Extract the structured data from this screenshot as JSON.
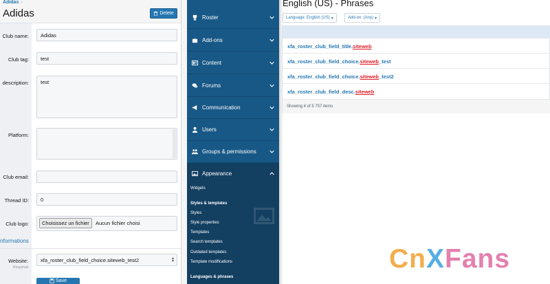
{
  "left": {
    "breadcrumb": "Adidas",
    "breadcrumb_sep": "›",
    "title": "Adidas",
    "delete_label": "Delete",
    "fields": {
      "club_name_label": "Club name:",
      "club_name_value": "Adidas",
      "club_tag_label": "Club tag:",
      "club_tag_value": "test",
      "description_label": "description:",
      "description_value": "test",
      "platform_label": "Platform:",
      "club_email_label": "Club email:",
      "thread_id_label": "Thread ID:",
      "thread_id_value": "0",
      "club_logo_label": "Club logo:",
      "file_button": "Choisissez un fichier",
      "file_status": "Aucun fichier choisi"
    },
    "section_heading": "nformations",
    "website_label": "Website:",
    "required_label": "Required",
    "website_value": "xfa_roster_club_field_choice.siteweb_test2",
    "save_label": "Save"
  },
  "nav": {
    "items": [
      {
        "label": "Roster",
        "icon": "trophy-icon"
      },
      {
        "label": "Add-ons",
        "icon": "puzzle-icon"
      },
      {
        "label": "Content",
        "icon": "content-icon"
      },
      {
        "label": "Forums",
        "icon": "forums-icon"
      },
      {
        "label": "Communication",
        "icon": "megaphone-icon"
      },
      {
        "label": "Users",
        "icon": "user-icon"
      },
      {
        "label": "Groups & permissions",
        "icon": "users-group-icon"
      },
      {
        "label": "Appearance",
        "icon": "image-icon"
      }
    ],
    "sub_items": [
      {
        "label": "Widgets",
        "bold": false
      },
      {
        "label": "Styles & templates",
        "bold": true
      },
      {
        "label": "Styles",
        "bold": false
      },
      {
        "label": "Style properties",
        "bold": false
      },
      {
        "label": "Templates",
        "bold": false
      },
      {
        "label": "Search templates",
        "bold": false
      },
      {
        "label": "Outdated templates",
        "bold": false
      },
      {
        "label": "Template modifications",
        "bold": false
      },
      {
        "label": "Languages & phrases",
        "bold": true
      }
    ]
  },
  "right": {
    "title": "English (US) - Phrases",
    "language_filter": "Language: English (US)",
    "addon_filter": "Add-on: (Any)",
    "rows": [
      {
        "prefix": "xfa_roster_club_field_title.",
        "highlight": "siteweb",
        "suffix": ""
      },
      {
        "prefix": "xfa_roster_club_field_choice.",
        "highlight": "siteweb",
        "suffix": "_test"
      },
      {
        "prefix": "xfa_roster_club_field_choice.",
        "highlight": "siteweb",
        "suffix": "_test2"
      },
      {
        "prefix": "xfa_roster_club_field_desc.",
        "highlight": "siteweb",
        "suffix": ""
      }
    ],
    "footer": "Showing 4 of 5 757 items"
  },
  "watermark": {
    "parts": [
      {
        "text": "Cn",
        "color": "#f0a030"
      },
      {
        "text": "X",
        "color": "#3aa0e0"
      },
      {
        "text": "Fans",
        "color": "#e06aa0"
      }
    ]
  },
  "colors": {
    "accent": "#2577b1",
    "nav_bg": "#185886",
    "highlight": "#e0202a"
  }
}
